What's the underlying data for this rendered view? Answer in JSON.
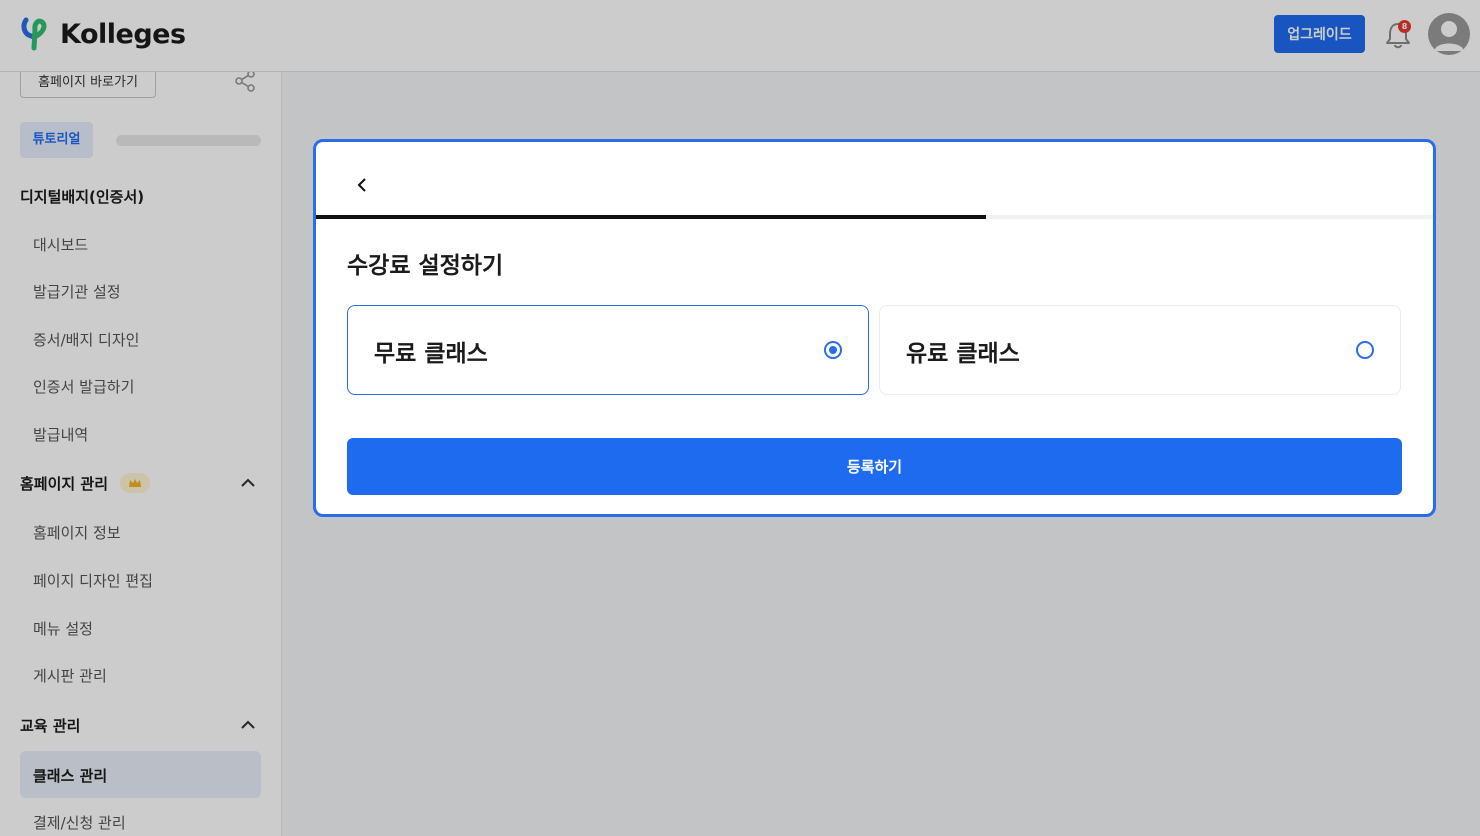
{
  "header": {
    "logo_text": "Kolleges",
    "upgrade_label": "업그레이드",
    "notification_count": "8"
  },
  "sidebar": {
    "home_link_label": "홈페이지 바로가기",
    "tutorial_label": "튜토리얼",
    "sections": [
      {
        "title": "디지털배지(인증서)",
        "items": [
          "대시보드",
          "발급기관 설정",
          "증서/배지 디자인",
          "인증서 발급하기",
          "발급내역"
        ]
      },
      {
        "title": "홈페이지 관리",
        "items": [
          "홈페이지 정보",
          "페이지 디자인 편집",
          "메뉴 설정",
          "게시판 관리"
        ]
      },
      {
        "title": "교육 관리",
        "items": [
          "클래스 관리",
          "결제/신청 관리"
        ]
      }
    ]
  },
  "modal": {
    "title": "수강료 설정하기",
    "progress": 0.6,
    "options": [
      {
        "label": "무료 클래스",
        "selected": true
      },
      {
        "label": "유료 클래스",
        "selected": false
      }
    ],
    "submit_label": "등록하기"
  },
  "colors": {
    "primary": "#1f6bf0",
    "badge_red": "#e8372c",
    "logo_green": "#2fbf71",
    "logo_blue": "#2a6de8"
  }
}
